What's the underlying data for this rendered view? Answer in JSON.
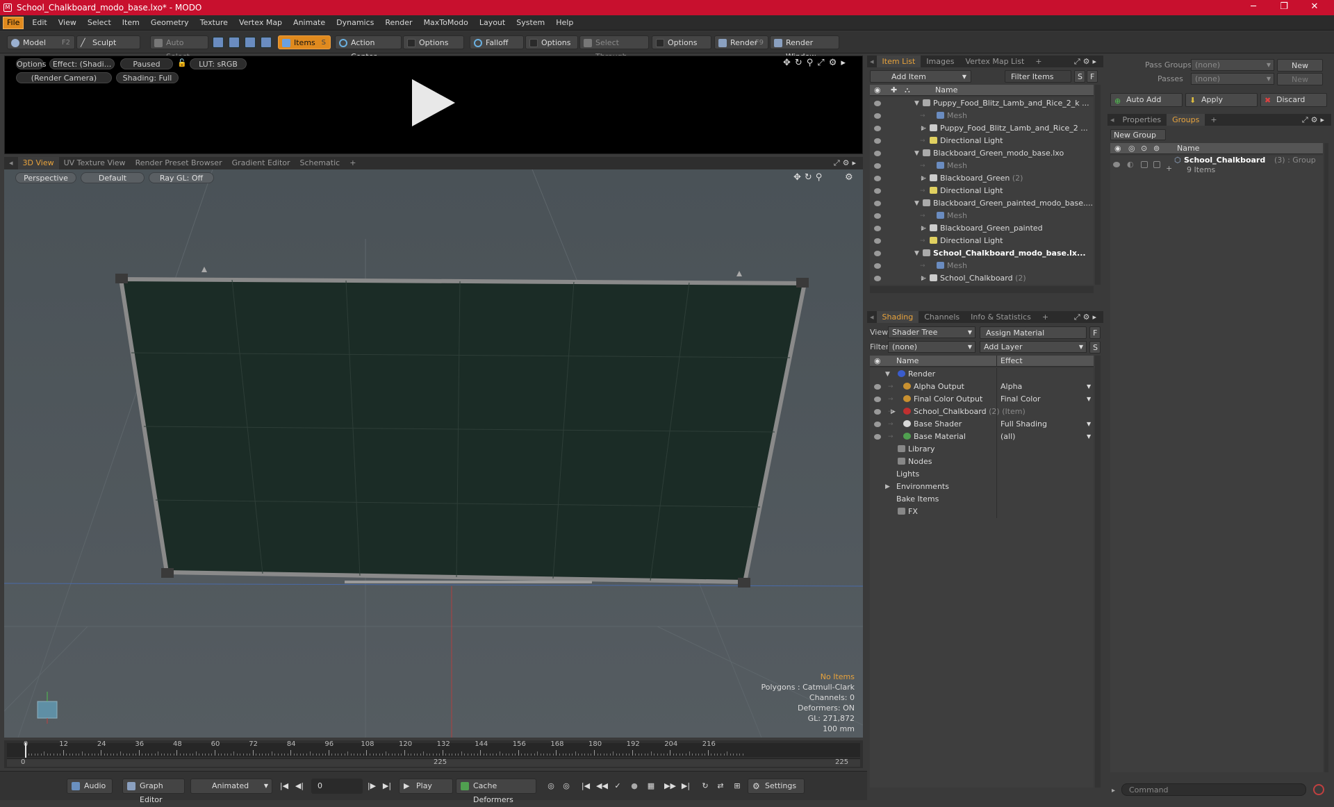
{
  "window": {
    "title": "School_Chalkboard_modo_base.lxo* - MODO",
    "minimize": "─",
    "maximize": "❐",
    "close": "✕"
  },
  "menu": [
    "File",
    "Edit",
    "View",
    "Select",
    "Item",
    "Geometry",
    "Texture",
    "Vertex Map",
    "Animate",
    "Dynamics",
    "Render",
    "MaxToModo",
    "Layout",
    "System",
    "Help"
  ],
  "toolbar": {
    "model": "Model",
    "model_key": "F2",
    "sculpt": "Sculpt",
    "auto_select": "Auto Select",
    "items": "Items",
    "items_key": "S",
    "action_center": "Action Center",
    "options1": "Options",
    "falloff": "Falloff",
    "options2": "Options",
    "select_through": "Select Through",
    "options3": "Options",
    "render": "Render",
    "render_key": "F9",
    "render_window": "Render Window"
  },
  "preview": {
    "options": "Options",
    "effect": "Effect: (Shadi...",
    "paused": "Paused",
    "lut": "LUT: sRGB",
    "camera": "(Render Camera)",
    "shading": "Shading: Full"
  },
  "viewport_tabs": [
    "3D View",
    "UV Texture View",
    "Render Preset Browser",
    "Gradient Editor",
    "Schematic",
    "+"
  ],
  "viewport": {
    "perspective": "Perspective",
    "default": "Default",
    "raygl": "Ray GL: Off",
    "stats": {
      "no_items": "No Items",
      "polygons": "Polygons : Catmull-Clark",
      "channels": "Channels: 0",
      "deformers": "Deformers: ON",
      "gl": "GL: 271,872",
      "scale": "100 mm"
    }
  },
  "timeline": {
    "ticks": [
      "0",
      "12",
      "24",
      "36",
      "48",
      "60",
      "72",
      "84",
      "96",
      "108",
      "120",
      "132",
      "144",
      "156",
      "168",
      "180",
      "192",
      "204",
      "216"
    ],
    "start": "0",
    "mid": "225",
    "end": "225"
  },
  "bottombar": {
    "audio": "Audio",
    "graph_editor": "Graph Editor",
    "animated": "Animated",
    "frame": "0",
    "play": "Play",
    "cache_deformers": "Cache Deformers",
    "settings": "Settings"
  },
  "item_list": {
    "tabs": [
      "Item List",
      "Images",
      "Vertex Map List",
      "+"
    ],
    "add_item": "Add Item",
    "filter_items": "Filter Items",
    "s": "S",
    "f": "F",
    "name_header": "Name",
    "rows": [
      {
        "label": "Puppy_Food_Blitz_Lamb_and_Rice_2_k ...",
        "indent": 0,
        "tri": "▼",
        "type": "scene"
      },
      {
        "label": "Mesh",
        "indent": 2,
        "tri": "",
        "type": "mesh"
      },
      {
        "label": "Puppy_Food_Blitz_Lamb_and_Rice_2 ...",
        "indent": 1,
        "tri": "▶",
        "type": "group"
      },
      {
        "label": "Directional Light",
        "indent": 1,
        "tri": "",
        "type": "light"
      },
      {
        "label": "Blackboard_Green_modo_base.lxo",
        "indent": 0,
        "tri": "▼",
        "type": "scene"
      },
      {
        "label": "Mesh",
        "indent": 2,
        "tri": "",
        "type": "mesh"
      },
      {
        "label": "Blackboard_Green",
        "suffix": "(2)",
        "indent": 1,
        "tri": "▶",
        "type": "group"
      },
      {
        "label": "Directional Light",
        "indent": 1,
        "tri": "",
        "type": "light"
      },
      {
        "label": "Blackboard_Green_painted_modo_base....",
        "indent": 0,
        "tri": "▼",
        "type": "scene"
      },
      {
        "label": "Mesh",
        "indent": 2,
        "tri": "",
        "type": "mesh"
      },
      {
        "label": "Blackboard_Green_painted",
        "indent": 1,
        "tri": "▶",
        "type": "group"
      },
      {
        "label": "Directional Light",
        "indent": 1,
        "tri": "",
        "type": "light"
      },
      {
        "label": "School_Chalkboard_modo_base.lx...",
        "indent": 0,
        "tri": "▼",
        "type": "scene",
        "bold": true
      },
      {
        "label": "Mesh",
        "indent": 2,
        "tri": "",
        "type": "mesh"
      },
      {
        "label": "School_Chalkboard",
        "suffix": "(2)",
        "indent": 1,
        "tri": "▶",
        "type": "group"
      }
    ]
  },
  "shading": {
    "tabs": [
      "Shading",
      "Channels",
      "Info & Statistics",
      "+"
    ],
    "view_label": "View",
    "view_value": "Shader Tree",
    "assign_material": "Assign Material",
    "f": "F",
    "filter_label": "Filter",
    "filter_value": "(none)",
    "add_layer": "Add Layer",
    "s": "S",
    "name_header": "Name",
    "effect_header": "Effect",
    "rows": [
      {
        "label": "Render",
        "effect": "",
        "indent": 0,
        "tri": "▼",
        "eye": false,
        "color": "#3a5ccc"
      },
      {
        "label": "Alpha Output",
        "effect": "Alpha",
        "indent": 1,
        "tri": "",
        "eye": true,
        "color": "#c89030"
      },
      {
        "label": "Final Color Output",
        "effect": "Final Color",
        "indent": 1,
        "tri": "",
        "eye": true,
        "color": "#c89030"
      },
      {
        "label": "School_Chalkboard",
        "suffix": "(2) (Item)",
        "effect": "",
        "indent": 1,
        "tri": "▶",
        "eye": true,
        "color": "#c03030"
      },
      {
        "label": "Base Shader",
        "effect": "Full Shading",
        "indent": 1,
        "tri": "",
        "eye": true,
        "color": "#d8d8d8"
      },
      {
        "label": "Base Material",
        "effect": "(all)",
        "indent": 1,
        "tri": "",
        "eye": true,
        "color": "#50a050"
      },
      {
        "label": "Library",
        "effect": "",
        "indent": 0,
        "tri": "",
        "eye": false,
        "color": ""
      },
      {
        "label": "Nodes",
        "effect": "",
        "indent": 0,
        "tri": "",
        "eye": false,
        "color": ""
      },
      {
        "label": "Lights",
        "effect": "",
        "indent": -1,
        "tri": "",
        "eye": false,
        "color": ""
      },
      {
        "label": "Environments",
        "effect": "",
        "indent": -1,
        "tri": "▶",
        "eye": false,
        "color": ""
      },
      {
        "label": "Bake Items",
        "effect": "",
        "indent": -1,
        "tri": "",
        "eye": false,
        "color": ""
      },
      {
        "label": "FX",
        "effect": "",
        "indent": 0,
        "tri": "",
        "eye": false,
        "color": ""
      }
    ]
  },
  "groups_panel": {
    "pass_groups_label": "Pass Groups",
    "pass_groups_value": "(none)",
    "new1": "New",
    "passes_label": "Passes",
    "passes_value": "(none)",
    "new2": "New",
    "auto_add": "Auto Add",
    "apply": "Apply",
    "discard": "Discard",
    "tabs": [
      "Properties",
      "Groups",
      "+"
    ],
    "new_group": "New Group",
    "name_header": "Name",
    "group_name": "School_Chalkboard",
    "group_suffix": "(3) : Group",
    "group_items": "9 Items",
    "command_placeholder": "Command"
  },
  "colors": {
    "accent": "#e8a33c",
    "titlebar": "#c8102e",
    "board": "#1b2c26"
  }
}
